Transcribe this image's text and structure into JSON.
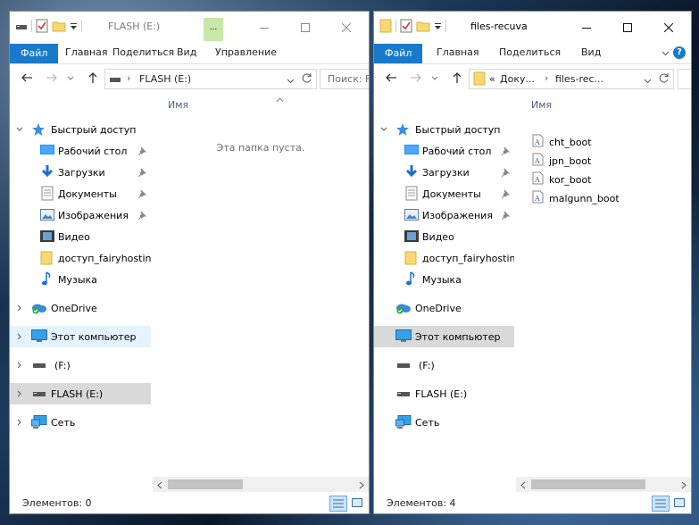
{
  "left": {
    "title": "FLASH (E:)",
    "context_tab_label": "...",
    "ribbon_tabs": [
      "Файл",
      "Главная",
      "Поделиться",
      "Вид",
      "Управление"
    ],
    "address": "FLASH (E:)",
    "search_placeholder": "Поиск: FLASH (E:)",
    "column_name": "Имя",
    "empty_message": "Эта папка пуста.",
    "status": "Элементов: 0"
  },
  "right": {
    "title": "files-recuva",
    "ribbon_tabs": [
      "Файл",
      "Главная",
      "Поделиться",
      "Вид"
    ],
    "address_prefix": "«",
    "address_parts": [
      "Доку...",
      "files-rec..."
    ],
    "column_name": "Имя",
    "files": [
      "cht_boot",
      "jpn_boot",
      "kor_boot",
      "malgunn_boot"
    ],
    "status": "Элементов: 4"
  },
  "nav": {
    "quick_access": "Быстрый доступ",
    "quick_items": [
      "Рабочий стол",
      "Загрузки",
      "Документы",
      "Изображения",
      "Видео",
      "доступ_fairyhosting",
      "Музыка"
    ],
    "onedrive": "OneDrive",
    "this_pc": "Этот компьютер",
    "drive_f": "(F:)",
    "drive_e": "FLASH (E:)",
    "network": "Сеть"
  },
  "colors": {
    "accent": "#1979ca",
    "selected": "#d9d9d9",
    "hover": "#e5f3ff",
    "context_tab": "#c8e8a8"
  }
}
